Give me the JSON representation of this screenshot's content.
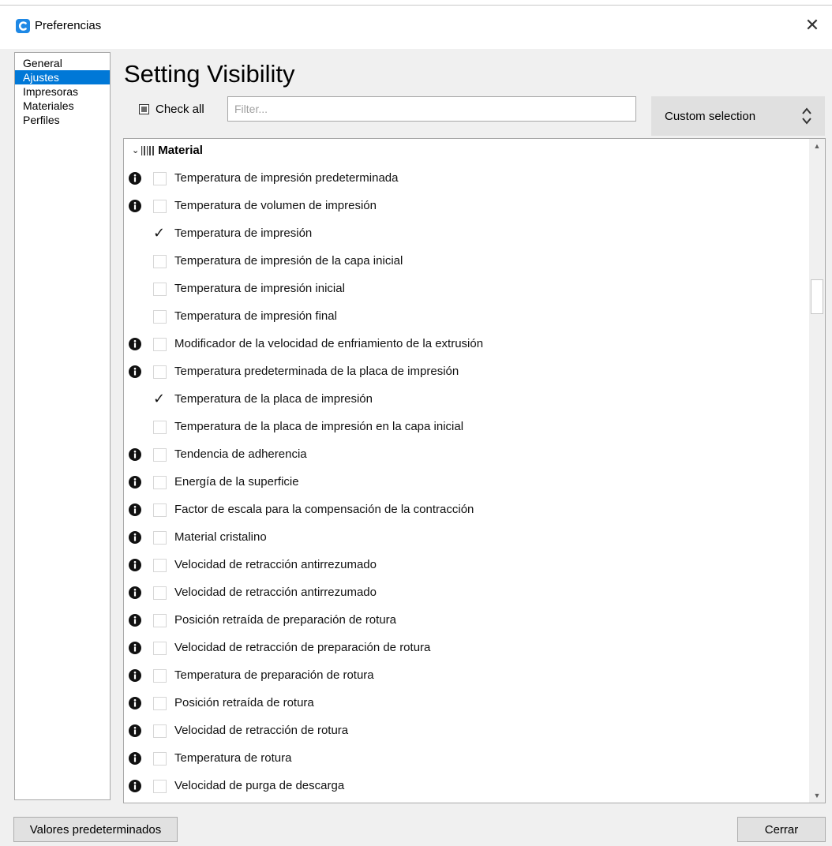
{
  "window": {
    "title": "Preferencias",
    "close_glyph": "✕"
  },
  "sidebar": {
    "items": [
      {
        "label": "General",
        "selected": false
      },
      {
        "label": "Ajustes",
        "selected": true
      },
      {
        "label": "Impresoras",
        "selected": false
      },
      {
        "label": "Materiales",
        "selected": false
      },
      {
        "label": "Perfiles",
        "selected": false
      }
    ]
  },
  "main": {
    "heading": "Setting Visibility",
    "check_all_label": "Check all",
    "filter": {
      "value": "",
      "placeholder": "Filter..."
    },
    "visibility_preset": {
      "label": "Custom selection"
    }
  },
  "settings": {
    "category": {
      "name": "Material",
      "expanded": true
    },
    "rows": [
      {
        "label": "Temperatura de impresión predeterminada",
        "info": true,
        "checked": false
      },
      {
        "label": "Temperatura de volumen de impresión",
        "info": true,
        "checked": false
      },
      {
        "label": "Temperatura de impresión",
        "info": false,
        "checked": true
      },
      {
        "label": "Temperatura de impresión de la capa inicial",
        "info": false,
        "checked": false
      },
      {
        "label": "Temperatura de impresión inicial",
        "info": false,
        "checked": false
      },
      {
        "label": "Temperatura de impresión final",
        "info": false,
        "checked": false
      },
      {
        "label": "Modificador de la velocidad de enfriamiento de la extrusión",
        "info": true,
        "checked": false
      },
      {
        "label": "Temperatura predeterminada de la placa de impresión",
        "info": true,
        "checked": false
      },
      {
        "label": "Temperatura de la placa de impresión",
        "info": false,
        "checked": true
      },
      {
        "label": "Temperatura de la placa de impresión en la capa inicial",
        "info": false,
        "checked": false
      },
      {
        "label": "Tendencia de adherencia",
        "info": true,
        "checked": false
      },
      {
        "label": "Energía de la superficie",
        "info": true,
        "checked": false
      },
      {
        "label": "Factor de escala para la compensación de la contracción",
        "info": true,
        "checked": false
      },
      {
        "label": "Material cristalino",
        "info": true,
        "checked": false
      },
      {
        "label": "Velocidad de retracción antirrezumado",
        "info": true,
        "checked": false
      },
      {
        "label": "Velocidad de retracción antirrezumado",
        "info": true,
        "checked": false
      },
      {
        "label": "Posición retraída de preparación de rotura",
        "info": true,
        "checked": false
      },
      {
        "label": "Velocidad de retracción de preparación de rotura",
        "info": true,
        "checked": false
      },
      {
        "label": "Temperatura de preparación de rotura",
        "info": true,
        "checked": false
      },
      {
        "label": "Posición retraída de rotura",
        "info": true,
        "checked": false
      },
      {
        "label": "Velocidad de retracción de rotura",
        "info": true,
        "checked": false
      },
      {
        "label": "Temperatura de rotura",
        "info": true,
        "checked": false
      },
      {
        "label": "Velocidad de purga de descarga",
        "info": true,
        "checked": false
      }
    ]
  },
  "footer": {
    "defaults_button": "Valores predeterminados",
    "close_button": "Cerrar"
  },
  "icons": {
    "app": "cura-logo-icon",
    "close": "close-icon",
    "info": "info-icon",
    "category": "material-category-icon",
    "expand": "chevron-down-icon",
    "preset_toggle": "chevron-updown-icon"
  },
  "colors": {
    "selection": "#0078d7",
    "app_logo": "#1e88e5"
  }
}
